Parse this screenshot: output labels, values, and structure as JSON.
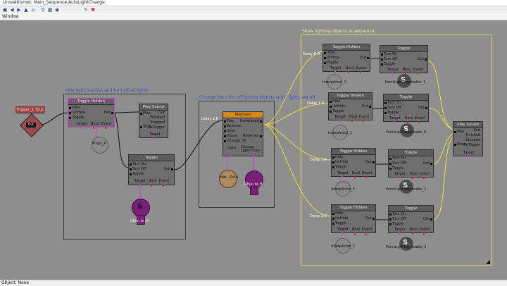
{
  "window": {
    "title": "UnrealKismet: Main_Sequence.AutoLightChange",
    "menu_window": "Window",
    "status": "Object: None"
  },
  "toolbar": {
    "icons": [
      "open-icon",
      "back-icon",
      "forward-icon",
      "up-icon",
      "home-icon",
      "search-icon",
      "grid-icon",
      "zoom-icon",
      "tool-icon",
      "stop-icon"
    ]
  },
  "comments": {
    "hide": "Hide light meshes and turn off all lights",
    "change": "Change the color of lighting objects while lights are off",
    "show": "Show lighting objects in sequence"
  },
  "nodes": {
    "trigger": {
      "title": "Trigger_1 Touch",
      "out": "Out"
    },
    "toggle_hidden_a": {
      "title": "Toggle Hidden",
      "pins": [
        "Hide",
        "UnHide",
        "Toggle"
      ],
      "out": "Out",
      "footer": [
        "Target",
        "Bool",
        "Event"
      ]
    },
    "play_sound_a": {
      "title": "Play Sound",
      "pins": [
        "Play",
        "Stop"
      ],
      "outs": [
        "Out",
        "Finished",
        "Stopped",
        "ReTrigger"
      ],
      "footer": "Target"
    },
    "toggle_a": {
      "title": "Toggle",
      "pins": [
        "Turn On",
        "Turn Off",
        "Toggle"
      ],
      "out": "Out",
      "footer": [
        "Target",
        "Bool",
        "Event"
      ]
    },
    "matinee": {
      "title": "Matinee",
      "delay": "Delay 2.0",
      "pins": [
        "Play",
        "Reverse",
        "Stop",
        "Pause",
        "Change Dir"
      ],
      "outs": [
        "Completed",
        "Reversed"
      ],
      "footer": [
        "Data",
        "Change Light Color"
      ]
    },
    "toggle_hidden_1": {
      "title": "Toggle Hidden",
      "delay": "Delay 0.0",
      "pins": [
        "Hide",
        "UnHide",
        "Toggle"
      ],
      "out": "Out",
      "footer": [
        "Target",
        "Bool",
        "Event"
      ]
    },
    "toggle_1": {
      "title": "Toggle",
      "pins": [
        "Turn On",
        "Turn Off",
        "Toggle"
      ],
      "out": "Out",
      "footer": [
        "Target",
        "Bool",
        "Event"
      ]
    },
    "toggle_hidden_2": {
      "title": "Toggle Hidden",
      "delay": "Delay 1.0",
      "pins": [
        "Hide",
        "UnHide",
        "Toggle"
      ],
      "out": "Out",
      "footer": [
        "Target",
        "Bool",
        "Event"
      ]
    },
    "toggle_2": {
      "title": "Toggle",
      "pins": [
        "Turn On",
        "Turn Off",
        "Toggle"
      ],
      "out": "Out",
      "footer": [
        "Target",
        "Bool",
        "Event"
      ]
    },
    "toggle_hidden_3": {
      "title": "Toggle Hidden",
      "delay": "Delay 1.5",
      "pins": [
        "Hide",
        "UnHide",
        "Toggle"
      ],
      "out": "Out",
      "footer": [
        "Target",
        "Bool",
        "Event"
      ]
    },
    "toggle_3": {
      "title": "Toggle",
      "pins": [
        "Turn On",
        "Turn Off",
        "Toggle"
      ],
      "out": "Out",
      "footer": [
        "Target",
        "Bool",
        "Event"
      ]
    },
    "toggle_hidden_4": {
      "title": "Toggle Hidden",
      "delay": "Delay 2.0",
      "pins": [
        "Hide",
        "UnHide",
        "Toggle"
      ],
      "out": "Out",
      "footer": [
        "Target",
        "Bool",
        "Event"
      ]
    },
    "toggle_4": {
      "title": "Toggle",
      "pins": [
        "Turn On",
        "Turn Off",
        "Toggle"
      ],
      "out": "Out",
      "footer": [
        "Target",
        "Bool",
        "Event"
      ]
    },
    "play_sound_b": {
      "title": "Play Sound",
      "pins": [
        "Play",
        "Stop"
      ],
      "outs": [
        "Out",
        "Finished",
        "Stopped",
        "ReTrigger"
      ],
      "footer": "Target"
    }
  },
  "variables": {
    "trig": "Trigger_1",
    "props_a": "Props_A",
    "obj_list_a": "Obje..te_A",
    "obj_list_b": "Obje..te_B",
    "matinee_data": "Mat...Data",
    "lights_b": "Obje..te_B",
    "inter_1": "InterpActor_2",
    "point_1": "PointLightToggleable_1",
    "inter_2": "InterpActor_1",
    "point_2": "PointLightToggleable_0",
    "inter_3": "InterpActor_3",
    "point_3": "PointLightToggleable_2",
    "inter_4": "InterpActor_0",
    "point_4": "PointLightToggleable_3"
  },
  "colors": {
    "wire_black": "#111111",
    "wire_yellow": "#e6df3c",
    "selection": "#d23cd2",
    "matinee_header": "#d4881c",
    "comment_blue": "#3a4ec8"
  }
}
